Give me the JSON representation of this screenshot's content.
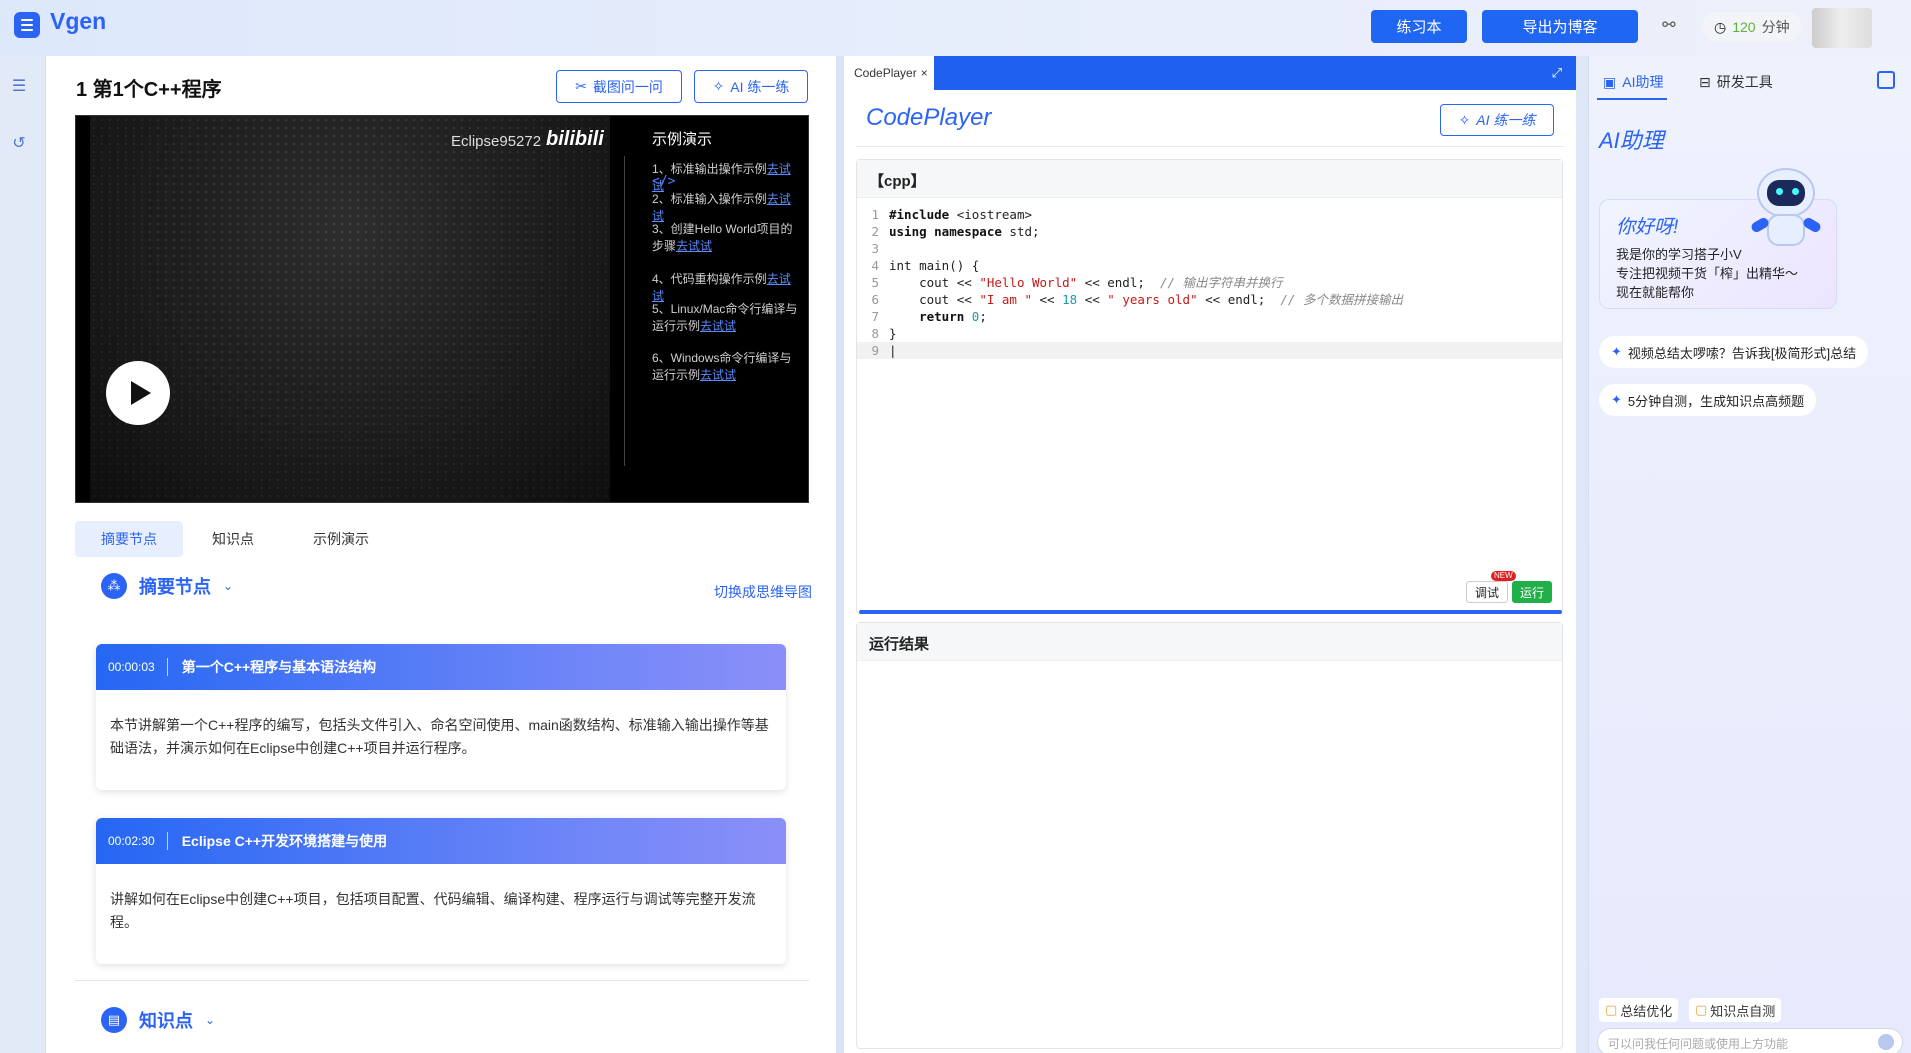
{
  "app": {
    "name": "Vgen"
  },
  "topbar": {
    "exercise_label": "练习本",
    "export_label": "导出为博客",
    "minutes_value": "120",
    "minutes_unit": "分钟"
  },
  "lesson": {
    "title": "1 第1个C++程序",
    "screenshot_ask": "截图问一问",
    "ai_practice": "AI 练一练"
  },
  "video": {
    "uploader": "Eclipse95272",
    "platform": "bilibili",
    "side_title": "示例演示",
    "side_items": [
      {
        "text": "1、标准输出操作示例",
        "link": "去试试"
      },
      {
        "text": "2、标准输入操作示例",
        "link": "去试试"
      },
      {
        "text": "3、创建Hello World项目的步骤",
        "link": "去试试"
      },
      {
        "text": "4、代码重构操作示例",
        "link": "去试试"
      },
      {
        "text": "5、Linux/Mac命令行编译与运行示例",
        "link": "去试试"
      },
      {
        "text": "6、Windows命令行编译与运行示例",
        "link": "去试试"
      }
    ]
  },
  "tabs": [
    "摘要节点",
    "知识点",
    "示例演示"
  ],
  "summary": {
    "heading": "摘要节点",
    "mindmap_link": "切换成思维导图",
    "cards": [
      {
        "time": "00:00:03",
        "title": "第一个C++程序与基本语法结构",
        "body": "本节讲解第一个C++程序的编写，包括头文件引入、命名空间使用、main函数结构、标准输入输出操作等基础语法，并演示如何在Eclipse中创建C++项目并运行程序。"
      },
      {
        "time": "00:02:30",
        "title": "Eclipse C++开发环境搭建与使用",
        "body": "讲解如何在Eclipse中创建C++项目，包括项目配置、代码编辑、编译构建、程序运行与调试等完整开发流程。"
      }
    ]
  },
  "knowledge": {
    "heading": "知识点"
  },
  "codeplayer": {
    "tab_label": "CodePlayer",
    "title": "CodePlayer",
    "ai_practice": "AI 练一练",
    "lang_label": "【cpp】",
    "line_numbers": [
      "1",
      "2",
      "3",
      "4",
      "5",
      "6",
      "7",
      "8",
      "9"
    ],
    "code_lines": [
      "#include <iostream>",
      "using namespace std;",
      "",
      "int main() {",
      "    cout << \"Hello World\" << endl;  // 输出字符串并换行",
      "    cout << \"I am \" << 18 << \" years old\" << endl;  // 多个数据拼接输出",
      "    return 0;",
      "}",
      ""
    ],
    "debug_label": "调试",
    "new_badge": "NEW",
    "run_label": "运行",
    "result_label": "运行结果"
  },
  "assistant": {
    "tab_ai": "AI助理",
    "tab_tools": "研发工具",
    "title": "AI助理",
    "hello_title": "你好呀!",
    "hello_lines": [
      "我是你的学习搭子小V",
      "专注把视频干货「榨」出精华～",
      "现在就能帮你"
    ],
    "suggestions": [
      "视频总结太啰嗦？告诉我[极简形式]总结",
      "5分钟自测，生成知识点高频题"
    ],
    "bottom_chips": [
      "总结优化",
      "知识点自测"
    ],
    "input_placeholder": "可以问我任何问题或使用上方功能"
  }
}
